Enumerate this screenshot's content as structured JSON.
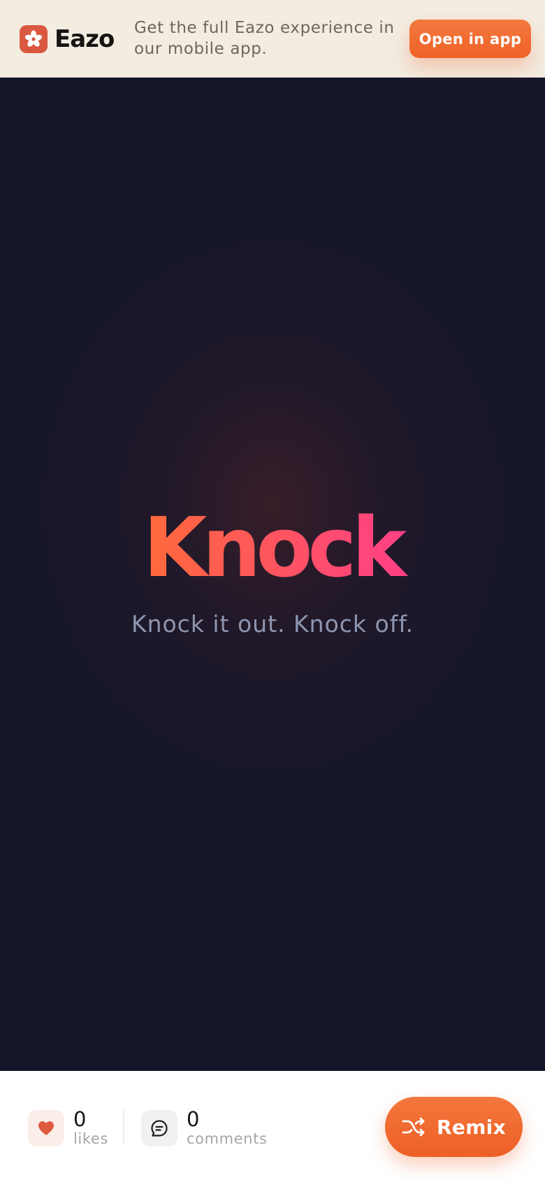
{
  "banner": {
    "brand_name": "Eazo",
    "message": "Get the full Eazo experience in our mobile app.",
    "open_app_label": "Open in app",
    "brand_color": "#d9583f",
    "brand_icon": "asterisk-logo-icon"
  },
  "hero": {
    "title": "Knock",
    "title_gradient": [
      "#ff6a3a",
      "#ff3f86"
    ],
    "tagline": "Knock it out. Knock off."
  },
  "stats": {
    "likes": {
      "count": "0",
      "label": "likes",
      "icon": "heart-icon"
    },
    "comments": {
      "count": "0",
      "label": "comments",
      "icon": "comment-icon"
    }
  },
  "actions": {
    "remix_label": "Remix",
    "remix_icon": "shuffle-icon",
    "accent_color": "#ee6227"
  },
  "theme": {
    "background": "#131629",
    "banner_background": "#f3ece1"
  }
}
